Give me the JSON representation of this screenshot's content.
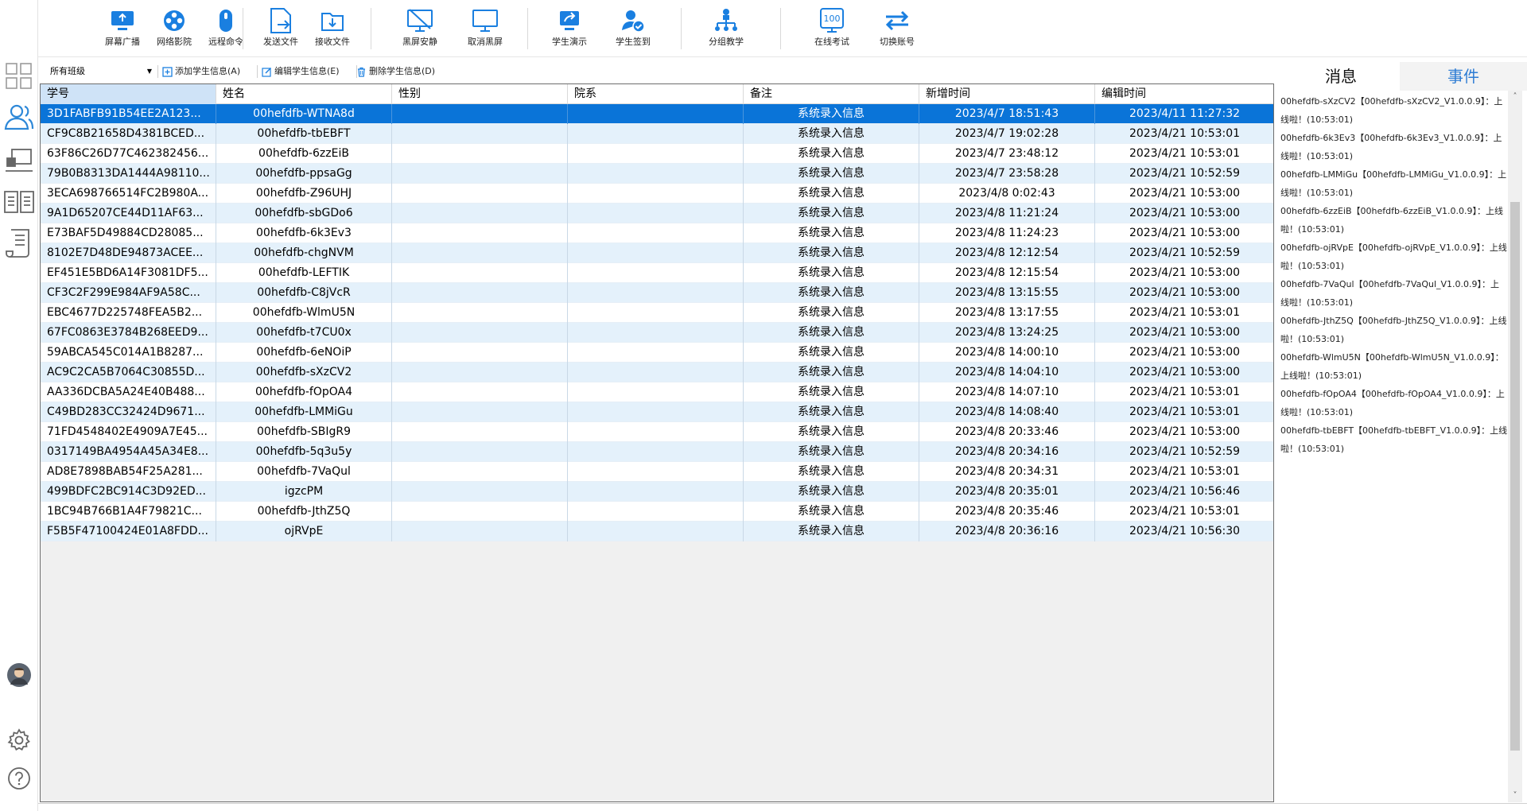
{
  "toolbar": {
    "items": [
      {
        "label": "屏幕广播",
        "icon": "screen-broadcast-icon"
      },
      {
        "label": "网络影院",
        "icon": "network-cinema-icon"
      },
      {
        "label": "远程命令",
        "icon": "remote-command-icon"
      },
      {
        "label": "发送文件",
        "icon": "send-file-icon"
      },
      {
        "label": "接收文件",
        "icon": "receive-file-icon"
      },
      {
        "label": "黑屏安静",
        "icon": "black-screen-icon"
      },
      {
        "label": "取消黑屏",
        "icon": "cancel-black-screen-icon"
      },
      {
        "label": "学生演示",
        "icon": "student-demo-icon"
      },
      {
        "label": "学生签到",
        "icon": "student-signin-icon"
      },
      {
        "label": "分组教学",
        "icon": "group-teaching-icon"
      },
      {
        "label": "在线考试",
        "icon": "online-exam-icon"
      },
      {
        "label": "切换账号",
        "icon": "switch-account-icon"
      }
    ]
  },
  "subbar": {
    "class_select": "所有班级",
    "add_label": "添加学生信息(A)",
    "edit_label": "编辑学生信息(E)",
    "delete_label": "删除学生信息(D)"
  },
  "grid": {
    "columns": [
      "学号",
      "姓名",
      "性别",
      "院系",
      "备注",
      "新增时间",
      "编辑时间"
    ],
    "rows": [
      [
        "3D1FABFB91B54EE2A123...",
        "00hefdfb-WTNA8d",
        "",
        "",
        "系统录入信息",
        "2023/4/7 18:51:43",
        "2023/4/11 11:27:32"
      ],
      [
        "CF9C8B21658D4381BCED...",
        "00hefdfb-tbEBFT",
        "",
        "",
        "系统录入信息",
        "2023/4/7 19:02:28",
        "2023/4/21 10:53:01"
      ],
      [
        "63F86C26D77C462382456...",
        "00hefdfb-6zzEiB",
        "",
        "",
        "系统录入信息",
        "2023/4/7 23:48:12",
        "2023/4/21 10:53:01"
      ],
      [
        "79B0B8313DA1444A98110...",
        "00hefdfb-ppsaGg",
        "",
        "",
        "系统录入信息",
        "2023/4/7 23:58:28",
        "2023/4/21 10:52:59"
      ],
      [
        "3ECA698766514FC2B980A...",
        "00hefdfb-Z96UHJ",
        "",
        "",
        "系统录入信息",
        "2023/4/8 0:02:43",
        "2023/4/21 10:53:00"
      ],
      [
        "9A1D65207CE44D11AF63...",
        "00hefdfb-sbGDo6",
        "",
        "",
        "系统录入信息",
        "2023/4/8 11:21:24",
        "2023/4/21 10:53:00"
      ],
      [
        "E73BAF5D49884CD28085...",
        "00hefdfb-6k3Ev3",
        "",
        "",
        "系统录入信息",
        "2023/4/8 11:24:23",
        "2023/4/21 10:53:00"
      ],
      [
        "8102E7D48DE94873ACEE...",
        "00hefdfb-chgNVM",
        "",
        "",
        "系统录入信息",
        "2023/4/8 12:12:54",
        "2023/4/21 10:52:59"
      ],
      [
        "EF451E5BD6A14F3081DF5...",
        "00hefdfb-LEFTIK",
        "",
        "",
        "系统录入信息",
        "2023/4/8 12:15:54",
        "2023/4/21 10:53:00"
      ],
      [
        "CF3C2F299E984AF9A58C...",
        "00hefdfb-C8jVcR",
        "",
        "",
        "系统录入信息",
        "2023/4/8 13:15:55",
        "2023/4/21 10:53:00"
      ],
      [
        "EBC4677D225748FEA5B2...",
        "00hefdfb-WlmU5N",
        "",
        "",
        "系统录入信息",
        "2023/4/8 13:17:55",
        "2023/4/21 10:53:01"
      ],
      [
        "67FC0863E3784B268EED9...",
        "00hefdfb-t7CU0x",
        "",
        "",
        "系统录入信息",
        "2023/4/8 13:24:25",
        "2023/4/21 10:53:00"
      ],
      [
        "59ABCA545C014A1B8287...",
        "00hefdfb-6eNOiP",
        "",
        "",
        "系统录入信息",
        "2023/4/8 14:00:10",
        "2023/4/21 10:53:00"
      ],
      [
        "AC9C2CA5B7064C30855D...",
        "00hefdfb-sXzCV2",
        "",
        "",
        "系统录入信息",
        "2023/4/8 14:04:10",
        "2023/4/21 10:53:00"
      ],
      [
        "AA336DCBA5A24E40B488...",
        "00hefdfb-fOpOA4",
        "",
        "",
        "系统录入信息",
        "2023/4/8 14:07:10",
        "2023/4/21 10:53:01"
      ],
      [
        "C49BD283CC32424D9671...",
        "00hefdfb-LMMiGu",
        "",
        "",
        "系统录入信息",
        "2023/4/8 14:08:40",
        "2023/4/21 10:53:01"
      ],
      [
        "71FD4548402E4909A7E45...",
        "00hefdfb-SBIgR9",
        "",
        "",
        "系统录入信息",
        "2023/4/8 20:33:46",
        "2023/4/21 10:53:00"
      ],
      [
        "0317149BA4954A45A34E8...",
        "00hefdfb-5q3u5y",
        "",
        "",
        "系统录入信息",
        "2023/4/8 20:34:16",
        "2023/4/21 10:52:59"
      ],
      [
        "AD8E7898BAB54F25A281...",
        "00hefdfb-7VaQul",
        "",
        "",
        "系统录入信息",
        "2023/4/8 20:34:31",
        "2023/4/21 10:53:01"
      ],
      [
        "499BDFC2BC914C3D92ED...",
        "igzcPM",
        "",
        "",
        "系统录入信息",
        "2023/4/8 20:35:01",
        "2023/4/21 10:56:46"
      ],
      [
        "1BC94B766B1A4F79821C...",
        "00hefdfb-JthZ5Q",
        "",
        "",
        "系统录入信息",
        "2023/4/8 20:35:46",
        "2023/4/21 10:53:01"
      ],
      [
        "F5B5F47100424E01A8FDD...",
        "ojRVpE",
        "",
        "",
        "系统录入信息",
        "2023/4/8 20:36:16",
        "2023/4/21 10:56:30"
      ]
    ],
    "selected_row": 0
  },
  "rightpanel": {
    "tab_messages": "消息",
    "tab_events": "事件",
    "messages": [
      "00hefdfb-sXzCV2【00hefdfb-sXzCV2_V1.0.0.9】：上线啦！(10:53:01)",
      "00hefdfb-6k3Ev3【00hefdfb-6k3Ev3_V1.0.0.9】：上线啦！(10:53:01)",
      "00hefdfb-LMMiGu【00hefdfb-LMMiGu_V1.0.0.9】：上线啦！(10:53:01)",
      "00hefdfb-6zzEiB【00hefdfb-6zzEiB_V1.0.0.9】：上线啦！(10:53:01)",
      "00hefdfb-ojRVpE【00hefdfb-ojRVpE_V1.0.0.9】：上线啦！(10:53:01)",
      "00hefdfb-7VaQul【00hefdfb-7VaQul_V1.0.0.9】：上线啦！(10:53:01)",
      "00hefdfb-JthZ5Q【00hefdfb-JthZ5Q_V1.0.0.9】：上线啦！(10:53:01)",
      "00hefdfb-WlmU5N【00hefdfb-WlmU5N_V1.0.0.9】：上线啦！(10:53:01)",
      "00hefdfb-fOpOA4【00hefdfb-fOpOA4_V1.0.0.9】：上线啦！(10:53:01)",
      "00hefdfb-tbEBFT【00hefdfb-tbEBFT_V1.0.0.9】：上线啦！(10:53:01)"
    ]
  },
  "colors": {
    "accent": "#1a7fe0",
    "selected_row": "#0a74d8",
    "alt_row": "#e4f1fb",
    "event_tab": "#2f7dd4"
  }
}
